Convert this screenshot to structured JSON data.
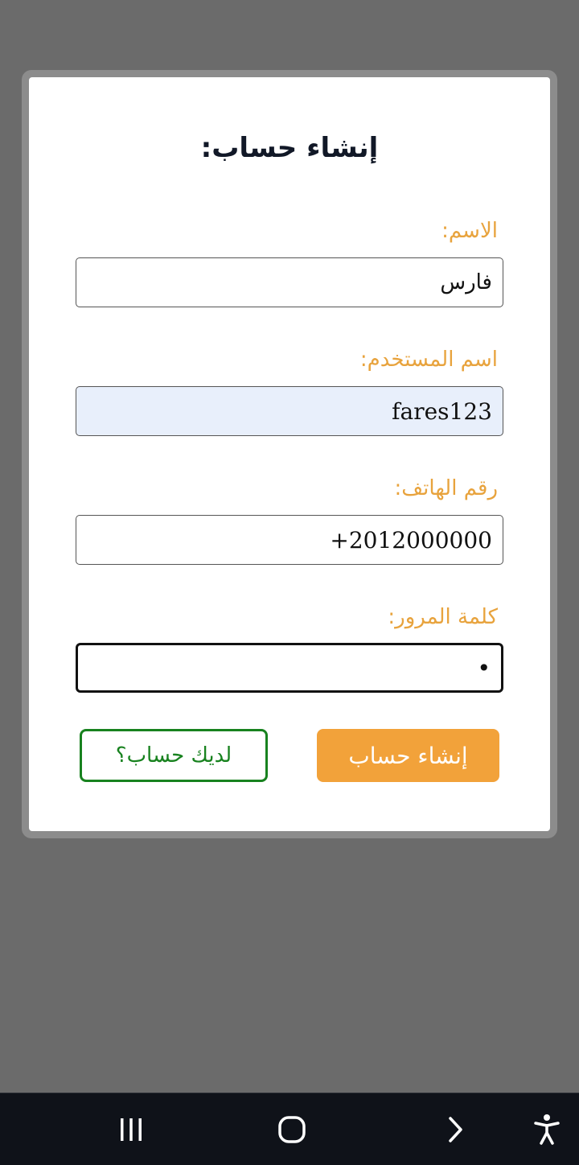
{
  "form": {
    "title": "إنشاء حساب:",
    "fields": [
      {
        "label": "الاسم:",
        "value": "فارس"
      },
      {
        "label": "اسم المستخدم:",
        "value": "fares123"
      },
      {
        "label": "رقم الهاتف:",
        "value": "+2012000000"
      },
      {
        "label": "كلمة المرور:",
        "value": "•"
      }
    ],
    "submit_label": "إنشاء حساب",
    "login_label": "لديك حساب؟"
  },
  "colors": {
    "label": "#e8a33d",
    "primary_button": "#f2a23a",
    "secondary_button": "#18821f",
    "autofill_bg": "#e8effb",
    "backdrop": "#6b6b6b",
    "navbar": "#0f1219"
  },
  "navbar": {
    "icons": [
      "recent-apps-icon",
      "home-icon",
      "back-icon",
      "accessibility-icon"
    ]
  }
}
